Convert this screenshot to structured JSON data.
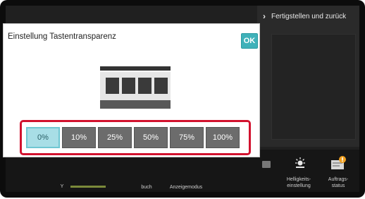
{
  "right_panel": {
    "header": "Fertigstellen und zurück"
  },
  "dialog": {
    "title": "Einstellung Tastentransparenz",
    "ok_label": "OK",
    "options": [
      "0%",
      "10%",
      "25%",
      "50%",
      "75%",
      "100%"
    ],
    "selected_index": 0
  },
  "bottom_bar": {
    "y_label": "Y",
    "item_buch": "buch",
    "item_anzeige": "Anzeigemodus",
    "helligkeit": "Helligkeits-\neinstellung",
    "auftrag": "Auftrags-\nstatus"
  },
  "colors": {
    "ok": "#3fb1b9",
    "selected_option": "#a8dee6",
    "highlight_frame": "#d2122e",
    "option": "#6c6c6c"
  }
}
